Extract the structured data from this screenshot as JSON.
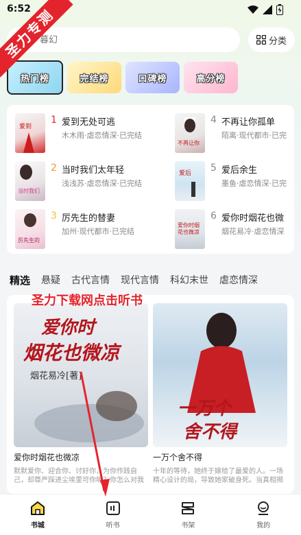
{
  "status": {
    "time": "6:52"
  },
  "watermark": {
    "ribbon": "圣力专测",
    "annotation": "圣力下载网点击听书"
  },
  "search": {
    "placeholder": "暮幻"
  },
  "category": {
    "label": "分类"
  },
  "rank_tabs": [
    {
      "label": "热门榜"
    },
    {
      "label": "完结榜"
    },
    {
      "label": "口碑榜"
    },
    {
      "label": "高分榜"
    }
  ],
  "rank_list": [
    {
      "num": "1",
      "title": "爱到无处可逃",
      "meta": "木木雨·虐恋情深·已完结"
    },
    {
      "num": "2",
      "title": "当时我们太年轻",
      "meta": "浅浅苏·虐恋情深·已完结"
    },
    {
      "num": "3",
      "title": "厉先生的替妻",
      "meta": "加州·现代都市·已完结"
    },
    {
      "num": "4",
      "title": "不再让你孤单",
      "meta": "陌离·现代都市·已完"
    },
    {
      "num": "5",
      "title": "爱后余生",
      "meta": "墨鱼·虐恋情深·已完"
    },
    {
      "num": "6",
      "title": "爱你时烟花也微",
      "meta": "烟花易冷·虐恋情深"
    }
  ],
  "genres": [
    "精选",
    "悬疑",
    "古代言情",
    "现代言情",
    "科幻末世",
    "虐恋情深"
  ],
  "books": [
    {
      "title": "爱你时烟花也微凉",
      "desc": "默默爱你、迎合你、讨好你，为你作践自己，却尊严踩进尘埃里可你呢？你怎么对我的",
      "cover_text": "爱你时烟花也微凉",
      "cover_author": "烟花易冷[著]"
    },
    {
      "title": "一万个舍不得",
      "desc": "十年的等待，她终于嫁给了最爱的人。一场精心设计的局，导致她家破身死。当真相揭开...",
      "cover_text": "一万个舍不得"
    }
  ],
  "nav": [
    {
      "label": "书城",
      "icon": "home-icon"
    },
    {
      "label": "听书",
      "icon": "listen-icon"
    },
    {
      "label": "书架",
      "icon": "bookshelf-icon"
    },
    {
      "label": "我的",
      "icon": "profile-icon"
    }
  ],
  "colors": {
    "accent": "#2bd5c1",
    "rank_red": "#e4242d",
    "rank_orange": "#f5933b",
    "rank_yellow": "#f5c23b",
    "rank_gray": "#888888"
  }
}
